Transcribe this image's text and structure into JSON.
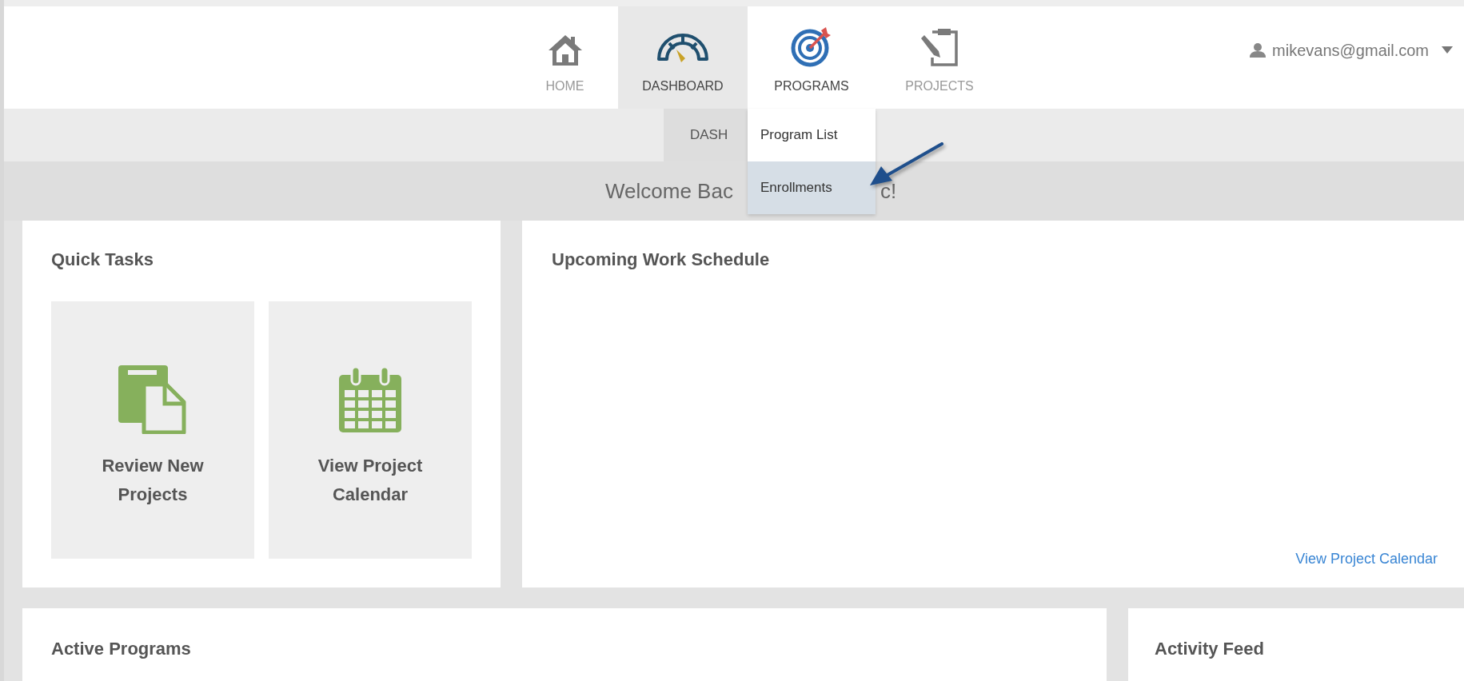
{
  "nav": {
    "items": [
      {
        "label": "HOME",
        "selected": false,
        "open": false
      },
      {
        "label": "DASHBOARD",
        "selected": true,
        "open": false
      },
      {
        "label": "PROGRAMS",
        "selected": false,
        "open": true
      },
      {
        "label": "PROJECTS",
        "selected": false,
        "open": false
      }
    ],
    "user": {
      "email": "mikevans@gmail.com"
    }
  },
  "subnav": {
    "items": [
      {
        "label": "DASH",
        "selected": true
      }
    ]
  },
  "dropdown": {
    "items": [
      {
        "label": "Program List",
        "selected": false
      },
      {
        "label": "Enrollments",
        "selected": true
      }
    ]
  },
  "welcome": {
    "text_before": "Welcome Bac",
    "text_after": "c!"
  },
  "quick_tasks": {
    "title": "Quick Tasks",
    "tiles": [
      {
        "label": "Review New Projects"
      },
      {
        "label": "View Project Calendar"
      }
    ]
  },
  "schedule": {
    "title": "Upcoming Work Schedule",
    "link": "View Project Calendar"
  },
  "active_programs": {
    "title": "Active Programs"
  },
  "activity_feed": {
    "title": "Activity Feed"
  }
}
